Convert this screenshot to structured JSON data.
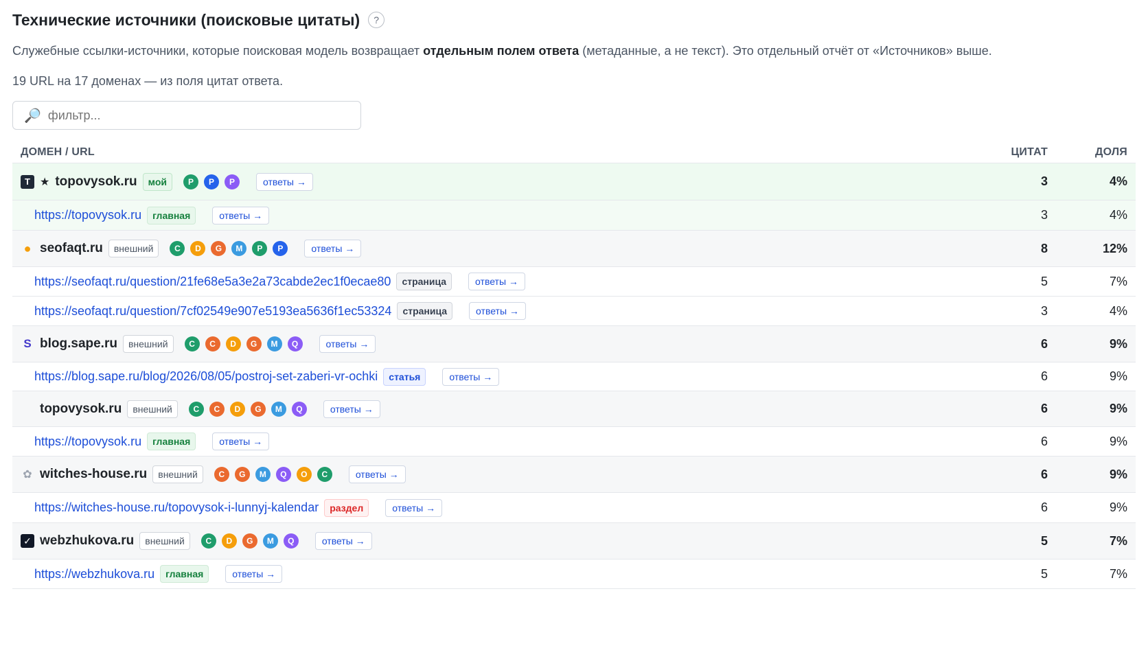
{
  "header": {
    "title": "Технические источники (поисковые цитаты)",
    "help": "?",
    "desc_pre": "Служебные ссылки-источники, которые поисковая модель возвращает ",
    "desc_bold": "отдельным полем ответа",
    "desc_post": " (метаданные, а не текст). Это отдельный отчёт от «Источников» выше.",
    "summary": "19 URL на 17 доменах — из поля цитат ответа."
  },
  "filter": {
    "placeholder": "фильтр...",
    "icon": "search-icon"
  },
  "table": {
    "col_domain": "ДОМЕН / URL",
    "col_cites": "ЦИТАТ",
    "col_share": "ДОЛЯ",
    "answers_label": "ответы →",
    "rows": [
      {
        "kind": "domain",
        "name": "topovysok.ru",
        "tag": "мой",
        "badges": [
          "P",
          "P",
          "P"
        ],
        "cites": "3",
        "share": "4%"
      },
      {
        "kind": "url",
        "url": "https://topovysok.ru",
        "tag": "главная",
        "cites": "3",
        "share": "4%"
      },
      {
        "kind": "domain",
        "name": "seofaqt.ru",
        "tag": "внешний",
        "badges": [
          "C",
          "D",
          "G",
          "M",
          "P",
          "P"
        ],
        "cites": "8",
        "share": "12%"
      },
      {
        "kind": "url",
        "url": "https://seofaqt.ru/question/21fe68e5a3e2a73cabde2ec1f0ecae80",
        "tag": "страница",
        "cites": "5",
        "share": "7%"
      },
      {
        "kind": "url",
        "url": "https://seofaqt.ru/question/7cf02549e907e5193ea5636f1ec53324",
        "tag": "страница",
        "cites": "3",
        "share": "4%"
      },
      {
        "kind": "domain",
        "name": "blog.sape.ru",
        "tag": "внешний",
        "badges": [
          "C",
          "C",
          "D",
          "G",
          "M",
          "Q"
        ],
        "cites": "6",
        "share": "9%"
      },
      {
        "kind": "url",
        "url": "https://blog.sape.ru/blog/2026/08/05/postroj-set-zaberi-vr-ochki",
        "tag": "статья",
        "cites": "6",
        "share": "9%"
      },
      {
        "kind": "domain",
        "name": "topovysok.ru",
        "tag": "внешний",
        "badges": [
          "C",
          "C",
          "D",
          "G",
          "M",
          "Q"
        ],
        "cites": "6",
        "share": "9%"
      },
      {
        "kind": "url",
        "url": "https://topovysok.ru",
        "tag": "главная",
        "cites": "6",
        "share": "9%"
      },
      {
        "kind": "domain",
        "name": "witches-house.ru",
        "tag": "внешний",
        "badges": [
          "C",
          "G",
          "M",
          "Q",
          "O",
          "C"
        ],
        "cites": "6",
        "share": "9%"
      },
      {
        "kind": "url",
        "url": "https://witches-house.ru/topovysok-i-lunnyj-kalendar",
        "tag": "раздел",
        "cites": "6",
        "share": "9%"
      },
      {
        "kind": "domain",
        "name": "webzhukova.ru",
        "tag": "внешний",
        "badges": [
          "C",
          "D",
          "G",
          "M",
          "Q"
        ],
        "cites": "5",
        "share": "7%"
      },
      {
        "kind": "url",
        "url": "https://webzhukova.ru",
        "tag": "главная",
        "cites": "5",
        "share": "7%"
      }
    ]
  }
}
